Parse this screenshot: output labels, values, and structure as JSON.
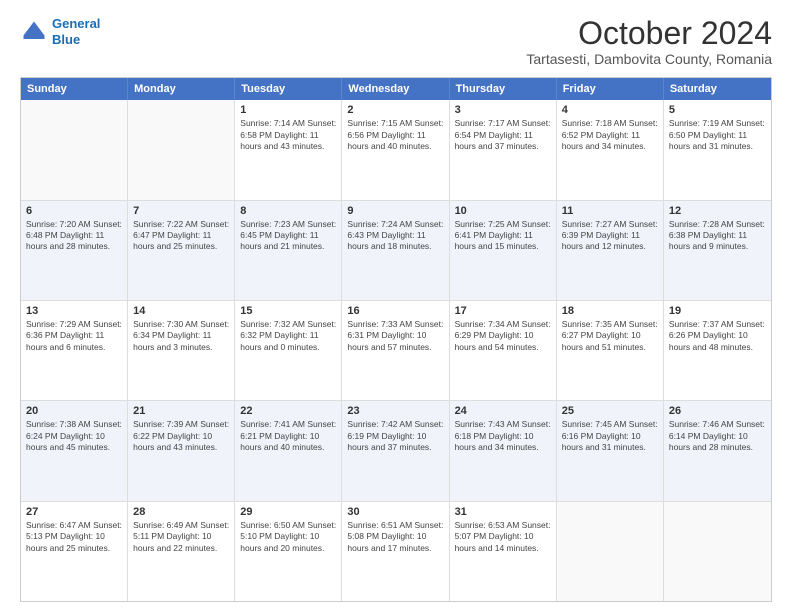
{
  "header": {
    "logo_line1": "General",
    "logo_line2": "Blue",
    "main_title": "October 2024",
    "subtitle": "Tartasesti, Dambovita County, Romania"
  },
  "calendar": {
    "days": [
      "Sunday",
      "Monday",
      "Tuesday",
      "Wednesday",
      "Thursday",
      "Friday",
      "Saturday"
    ],
    "rows": [
      [
        {
          "day": "",
          "info": ""
        },
        {
          "day": "",
          "info": ""
        },
        {
          "day": "1",
          "info": "Sunrise: 7:14 AM\nSunset: 6:58 PM\nDaylight: 11 hours and 43 minutes."
        },
        {
          "day": "2",
          "info": "Sunrise: 7:15 AM\nSunset: 6:56 PM\nDaylight: 11 hours and 40 minutes."
        },
        {
          "day": "3",
          "info": "Sunrise: 7:17 AM\nSunset: 6:54 PM\nDaylight: 11 hours and 37 minutes."
        },
        {
          "day": "4",
          "info": "Sunrise: 7:18 AM\nSunset: 6:52 PM\nDaylight: 11 hours and 34 minutes."
        },
        {
          "day": "5",
          "info": "Sunrise: 7:19 AM\nSunset: 6:50 PM\nDaylight: 11 hours and 31 minutes."
        }
      ],
      [
        {
          "day": "6",
          "info": "Sunrise: 7:20 AM\nSunset: 6:48 PM\nDaylight: 11 hours and 28 minutes."
        },
        {
          "day": "7",
          "info": "Sunrise: 7:22 AM\nSunset: 6:47 PM\nDaylight: 11 hours and 25 minutes."
        },
        {
          "day": "8",
          "info": "Sunrise: 7:23 AM\nSunset: 6:45 PM\nDaylight: 11 hours and 21 minutes."
        },
        {
          "day": "9",
          "info": "Sunrise: 7:24 AM\nSunset: 6:43 PM\nDaylight: 11 hours and 18 minutes."
        },
        {
          "day": "10",
          "info": "Sunrise: 7:25 AM\nSunset: 6:41 PM\nDaylight: 11 hours and 15 minutes."
        },
        {
          "day": "11",
          "info": "Sunrise: 7:27 AM\nSunset: 6:39 PM\nDaylight: 11 hours and 12 minutes."
        },
        {
          "day": "12",
          "info": "Sunrise: 7:28 AM\nSunset: 6:38 PM\nDaylight: 11 hours and 9 minutes."
        }
      ],
      [
        {
          "day": "13",
          "info": "Sunrise: 7:29 AM\nSunset: 6:36 PM\nDaylight: 11 hours and 6 minutes."
        },
        {
          "day": "14",
          "info": "Sunrise: 7:30 AM\nSunset: 6:34 PM\nDaylight: 11 hours and 3 minutes."
        },
        {
          "day": "15",
          "info": "Sunrise: 7:32 AM\nSunset: 6:32 PM\nDaylight: 11 hours and 0 minutes."
        },
        {
          "day": "16",
          "info": "Sunrise: 7:33 AM\nSunset: 6:31 PM\nDaylight: 10 hours and 57 minutes."
        },
        {
          "day": "17",
          "info": "Sunrise: 7:34 AM\nSunset: 6:29 PM\nDaylight: 10 hours and 54 minutes."
        },
        {
          "day": "18",
          "info": "Sunrise: 7:35 AM\nSunset: 6:27 PM\nDaylight: 10 hours and 51 minutes."
        },
        {
          "day": "19",
          "info": "Sunrise: 7:37 AM\nSunset: 6:26 PM\nDaylight: 10 hours and 48 minutes."
        }
      ],
      [
        {
          "day": "20",
          "info": "Sunrise: 7:38 AM\nSunset: 6:24 PM\nDaylight: 10 hours and 45 minutes."
        },
        {
          "day": "21",
          "info": "Sunrise: 7:39 AM\nSunset: 6:22 PM\nDaylight: 10 hours and 43 minutes."
        },
        {
          "day": "22",
          "info": "Sunrise: 7:41 AM\nSunset: 6:21 PM\nDaylight: 10 hours and 40 minutes."
        },
        {
          "day": "23",
          "info": "Sunrise: 7:42 AM\nSunset: 6:19 PM\nDaylight: 10 hours and 37 minutes."
        },
        {
          "day": "24",
          "info": "Sunrise: 7:43 AM\nSunset: 6:18 PM\nDaylight: 10 hours and 34 minutes."
        },
        {
          "day": "25",
          "info": "Sunrise: 7:45 AM\nSunset: 6:16 PM\nDaylight: 10 hours and 31 minutes."
        },
        {
          "day": "26",
          "info": "Sunrise: 7:46 AM\nSunset: 6:14 PM\nDaylight: 10 hours and 28 minutes."
        }
      ],
      [
        {
          "day": "27",
          "info": "Sunrise: 6:47 AM\nSunset: 5:13 PM\nDaylight: 10 hours and 25 minutes."
        },
        {
          "day": "28",
          "info": "Sunrise: 6:49 AM\nSunset: 5:11 PM\nDaylight: 10 hours and 22 minutes."
        },
        {
          "day": "29",
          "info": "Sunrise: 6:50 AM\nSunset: 5:10 PM\nDaylight: 10 hours and 20 minutes."
        },
        {
          "day": "30",
          "info": "Sunrise: 6:51 AM\nSunset: 5:08 PM\nDaylight: 10 hours and 17 minutes."
        },
        {
          "day": "31",
          "info": "Sunrise: 6:53 AM\nSunset: 5:07 PM\nDaylight: 10 hours and 14 minutes."
        },
        {
          "day": "",
          "info": ""
        },
        {
          "day": "",
          "info": ""
        }
      ]
    ]
  }
}
